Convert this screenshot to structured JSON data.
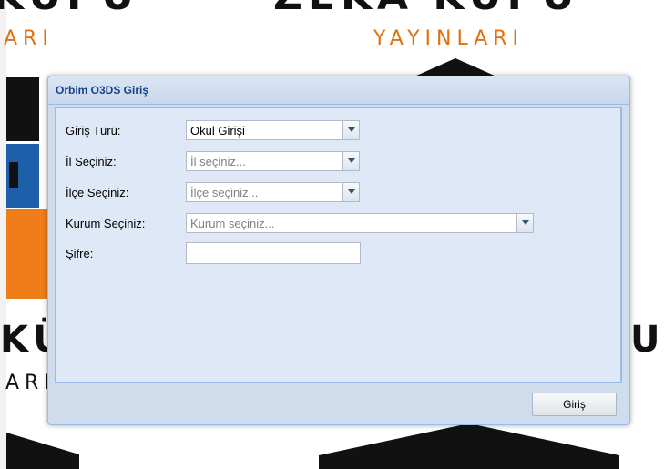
{
  "background": {
    "top_brand_left": "KUPU",
    "top_brand_right": "ZEKA KUPU",
    "top_sub_left": "ARI",
    "top_sub_right": "YAYINLARI",
    "mid_brand_left": "KÜ",
    "mid_brand_right": "U",
    "mid_sub_left": "ARI",
    "accent_orange": "#ef7d1a"
  },
  "dialog": {
    "title": "Orbim O3DS Giriş",
    "fields": {
      "login_type": {
        "label": "Giriş Türü:",
        "value": "Okul Girişi"
      },
      "province": {
        "label": "İl Seçiniz:",
        "placeholder": "İl seçiniz..."
      },
      "district": {
        "label": "İlçe Seçiniz:",
        "placeholder": "İlçe seçiniz..."
      },
      "institution": {
        "label": "Kurum Seçiniz:",
        "placeholder": "Kurum seçiniz..."
      },
      "password": {
        "label": "Şifre:",
        "value": ""
      }
    },
    "submit_label": "Giriş"
  }
}
